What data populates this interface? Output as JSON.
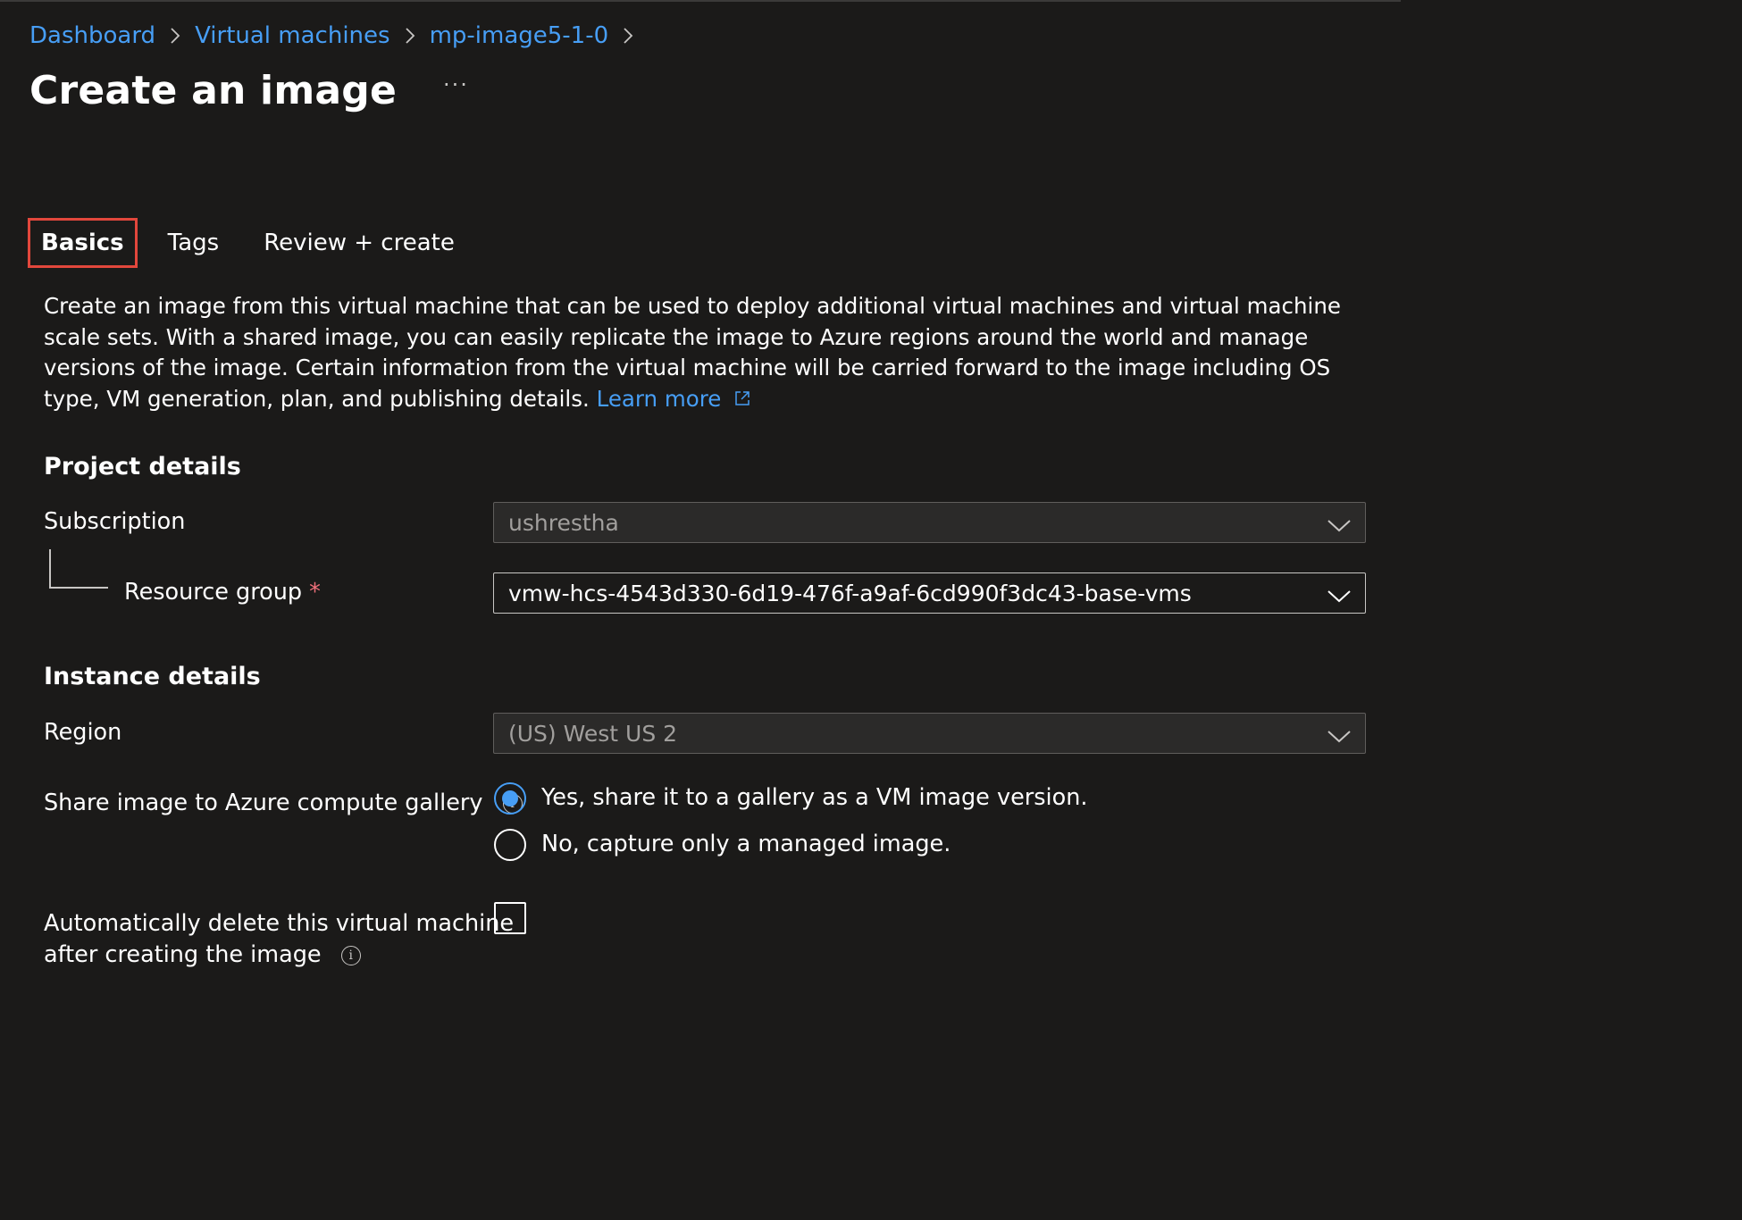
{
  "breadcrumb": {
    "items": [
      "Dashboard",
      "Virtual machines",
      "mp-image5-1-0"
    ]
  },
  "header": {
    "title": "Create an image",
    "more": "···"
  },
  "tabs": [
    "Basics",
    "Tags",
    "Review + create"
  ],
  "description": {
    "text": "Create an image from this virtual machine that can be used to deploy additional virtual machines and virtual machine scale sets. With a shared image, you can easily replicate the image to Azure regions around the world and manage versions of the image. Certain information from the virtual machine will be carried forward to the image including OS type, VM generation, plan, and publishing details.",
    "learn_more": "Learn more"
  },
  "project_details": {
    "heading": "Project details",
    "subscription_label": "Subscription",
    "subscription_value": "ushrestha",
    "resource_group_label": "Resource group",
    "required_mark": "*",
    "resource_group_value": "vmw-hcs-4543d330-6d19-476f-a9af-6cd990f3dc43-base-vms"
  },
  "instance_details": {
    "heading": "Instance details",
    "region_label": "Region",
    "region_value": "(US) West US 2",
    "share_label": "Share image to Azure compute gallery",
    "share_options": [
      "Yes, share it to a gallery as a VM image version.",
      "No, capture only a managed image."
    ],
    "share_selected": 0,
    "auto_delete_label_line1": "Automatically delete this virtual machine",
    "auto_delete_label_line2": "after creating the image",
    "auto_delete_checked": false
  },
  "colors": {
    "background": "#1b1a19",
    "link": "#479ef5",
    "active_tab_highlight": "#e2473c",
    "required": "#f1707b"
  },
  "icons": {
    "breadcrumb_separator": "chevron-right-icon",
    "dropdown": "chevron-down-icon",
    "info": "info-icon",
    "external_link": "external-link-icon"
  }
}
